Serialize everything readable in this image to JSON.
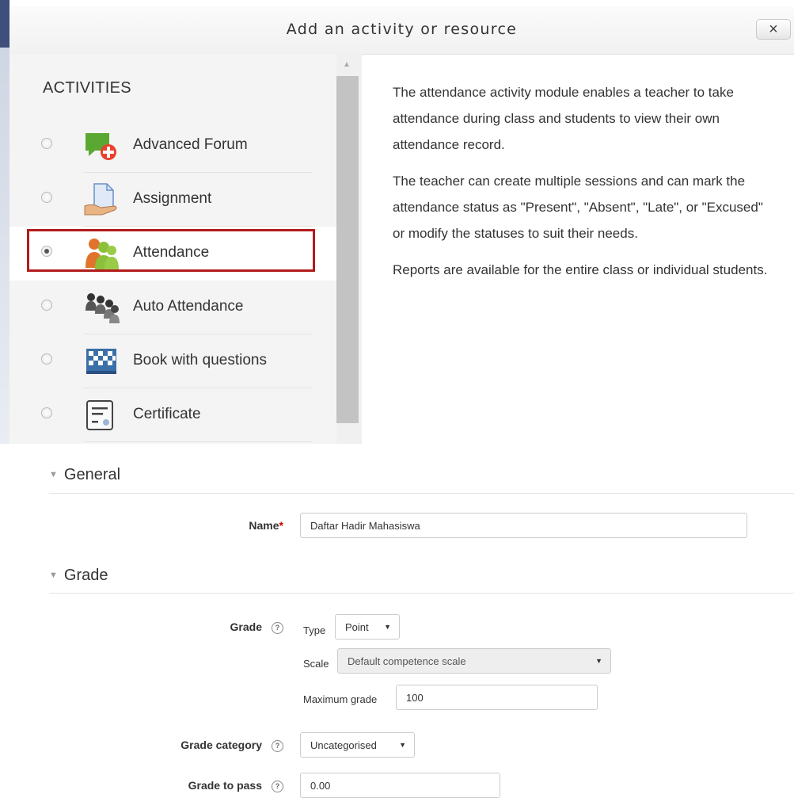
{
  "modal": {
    "title": "Add an activity or resource",
    "close_label": "×",
    "section_heading": "ACTIVITIES",
    "options": [
      {
        "label": "Advanced Forum",
        "icon": "advanced-forum-icon",
        "selected": false
      },
      {
        "label": "Assignment",
        "icon": "assignment-icon",
        "selected": false
      },
      {
        "label": "Attendance",
        "icon": "attendance-icon",
        "selected": true
      },
      {
        "label": "Auto Attendance",
        "icon": "auto-attendance-icon",
        "selected": false
      },
      {
        "label": "Book with questions",
        "icon": "book-with-questions-icon",
        "selected": false
      },
      {
        "label": "Certificate",
        "icon": "certificate-icon",
        "selected": false
      }
    ],
    "description": [
      "The attendance activity module enables a teacher to take attendance during class and students to view their own attendance record.",
      "The teacher can create multiple sessions and can mark the attendance status as \"Present\", \"Absent\", \"Late\", or \"Excused\" or modify the statuses to suit their needs.",
      "Reports are available for the entire class or individual students."
    ],
    "highlight_color": "#b31b1b"
  },
  "form": {
    "general": {
      "legend": "General",
      "name_label": "Name",
      "required_mark": "*",
      "name_value": "Daftar Hadir Mahasiswa"
    },
    "grade": {
      "legend": "Grade",
      "grade_label": "Grade",
      "type_label": "Type",
      "type_value": "Point",
      "scale_label": "Scale",
      "scale_value": "Default competence scale",
      "max_grade_label": "Maximum grade",
      "max_grade_value": "100",
      "category_label": "Grade category",
      "category_value": "Uncategorised",
      "pass_label": "Grade to pass",
      "pass_value": "0.00"
    }
  }
}
